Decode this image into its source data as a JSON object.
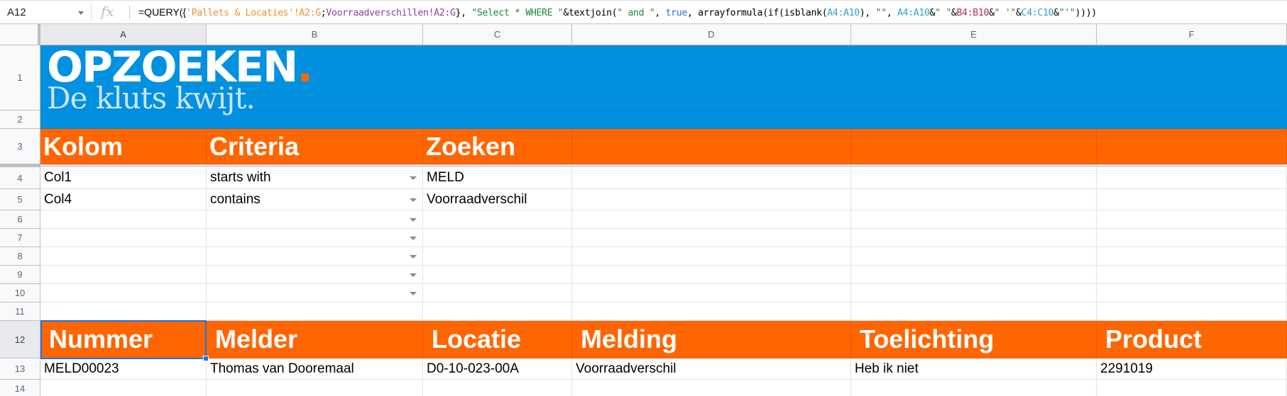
{
  "formula_bar": {
    "cell_ref": "A12",
    "fx_icon": "fx",
    "formula_parts": [
      {
        "text": "=QUERY({",
        "color": "fn"
      },
      {
        "text": "'Pallets & Locaties'!A2:G",
        "color": "orange"
      },
      {
        "text": ";",
        "color": "default"
      },
      {
        "text": "Voorraadverschillen!A2:G",
        "color": "purple"
      },
      {
        "text": "}, ",
        "color": "default"
      },
      {
        "text": "\"Select * WHERE \"",
        "color": "green"
      },
      {
        "text": "&textjoin(",
        "color": "default"
      },
      {
        "text": "\" and \"",
        "color": "green"
      },
      {
        "text": ", ",
        "color": "default"
      },
      {
        "text": "true",
        "color": "blue"
      },
      {
        "text": ", arrayformula(if(isblank(",
        "color": "default"
      },
      {
        "text": "A4:A10",
        "color": "teal"
      },
      {
        "text": "), ",
        "color": "default"
      },
      {
        "text": "\"\"",
        "color": "green"
      },
      {
        "text": ", ",
        "color": "default"
      },
      {
        "text": "A4:A10",
        "color": "teal"
      },
      {
        "text": "&",
        "color": "default"
      },
      {
        "text": "\" \"",
        "color": "green"
      },
      {
        "text": "&",
        "color": "default"
      },
      {
        "text": "B4:B10",
        "color": "maroon"
      },
      {
        "text": "&",
        "color": "default"
      },
      {
        "text": "\" '\"",
        "color": "green"
      },
      {
        "text": "&",
        "color": "default"
      },
      {
        "text": "C4:C10",
        "color": "teal"
      },
      {
        "text": "&",
        "color": "default"
      },
      {
        "text": "\"'\"",
        "color": "green"
      },
      {
        "text": "))))",
        "color": "default"
      }
    ]
  },
  "columns": [
    "A",
    "B",
    "C",
    "D",
    "E",
    "F"
  ],
  "rows": [
    "1",
    "2",
    "3",
    "4",
    "5",
    "6",
    "7",
    "8",
    "9",
    "10",
    "11",
    "12",
    "13",
    "14"
  ],
  "logo": {
    "title": "OPZOEKEN",
    "dot": ".",
    "subtitle": "De kluts kwijt."
  },
  "search_header": [
    "Kolom",
    "Criteria",
    "Zoeken",
    "",
    "",
    ""
  ],
  "criteria_rows": [
    {
      "kolom": "Col1",
      "criteria": "starts with",
      "zoeken": "MELD"
    },
    {
      "kolom": "Col4",
      "criteria": "contains",
      "zoeken": "Voorraadverschil"
    },
    {
      "kolom": "",
      "criteria": "",
      "zoeken": ""
    },
    {
      "kolom": "",
      "criteria": "",
      "zoeken": ""
    },
    {
      "kolom": "",
      "criteria": "",
      "zoeken": ""
    },
    {
      "kolom": "",
      "criteria": "",
      "zoeken": ""
    },
    {
      "kolom": "",
      "criteria": "",
      "zoeken": ""
    }
  ],
  "results_header": [
    "Nummer",
    "Melder",
    "Locatie",
    "Melding",
    "Toelichting",
    "Product"
  ],
  "results_rows": [
    [
      "MELD00023",
      "Thomas van Dooremaal",
      "D0-10-023-00A",
      "Voorraadverschil",
      "Heb ik niet",
      "2291019"
    ]
  ],
  "colors": {
    "banner_blue": "#0290e1",
    "header_orange": "#ff6600",
    "selection_blue": "#1a73e8"
  }
}
